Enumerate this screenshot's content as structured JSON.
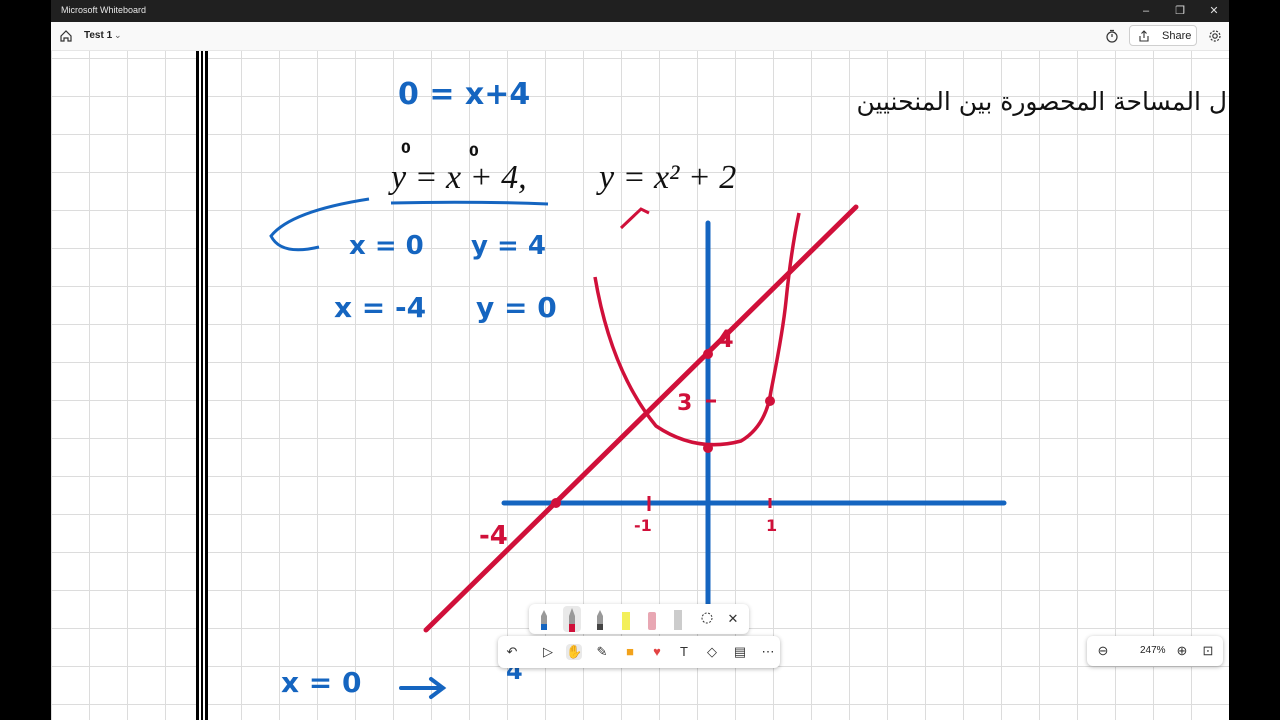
{
  "window": {
    "title": "Microsoft Whiteboard",
    "minimize": "–",
    "maximize": "❐",
    "close": "✕"
  },
  "appbar": {
    "document_name": "Test 1",
    "share_label": "Share"
  },
  "board": {
    "heading": "ل المساحة المحصورة بين المنحنيين",
    "equation_1": "y = x + 4,",
    "equation_2": "y = x² + 2",
    "notes": {
      "top": "0 = x+4",
      "zero_marks": "0",
      "row1_x": "x = 0",
      "row1_y": "y = 4",
      "row2_x": "x = -4",
      "row2_y": "y = 0",
      "bottom_x": "x = 0",
      "bottom_value": "4"
    },
    "graph_labels": {
      "y4": "4",
      "y3": "3",
      "x_neg4": "-4",
      "x_neg1": "-1",
      "x_1": "1"
    }
  },
  "toolbar": {
    "items": [
      "undo",
      "select",
      "pan",
      "pen",
      "sticky",
      "reaction",
      "text",
      "shapes",
      "templates",
      "more"
    ]
  },
  "pen_tray": {
    "items": [
      "blue pen",
      "red pen",
      "grey pen",
      "highlighter",
      "eraser",
      "ruler",
      "lasso",
      "close"
    ]
  },
  "zoom": {
    "value": "247%"
  },
  "colors": {
    "ink_blue": "#1565c0",
    "ink_red": "#d0103a",
    "grid": "#dcdcdc"
  }
}
